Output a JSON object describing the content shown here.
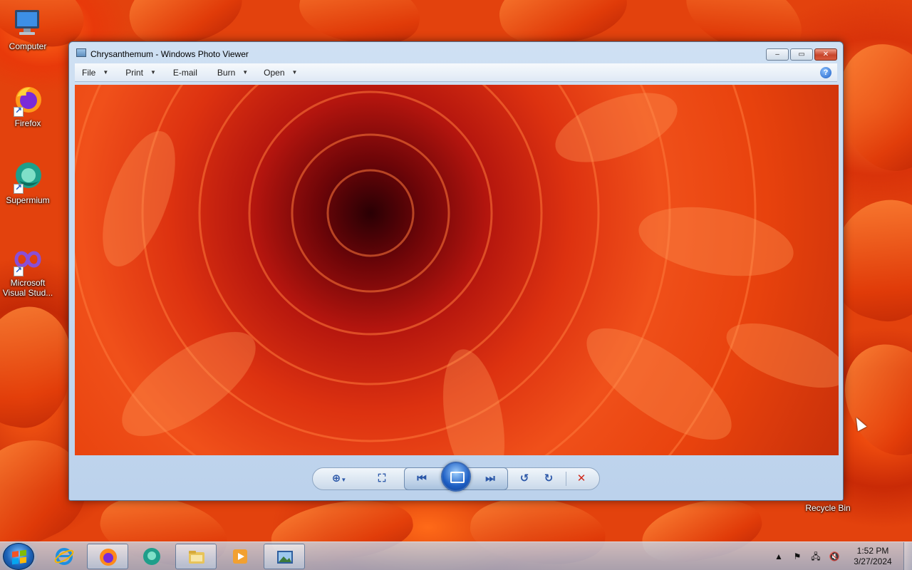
{
  "desktop": {
    "icons": [
      {
        "label": "Computer",
        "icon": "computer-icon"
      },
      {
        "label": "Firefox",
        "icon": "firefox-icon"
      },
      {
        "label": "Supermium",
        "icon": "supermium-icon"
      },
      {
        "label": "Microsoft Visual Stud...",
        "icon": "visual-studio-icon"
      }
    ],
    "recycle_bin_label": "Recycle Bin"
  },
  "window": {
    "title": "Chrysanthemum - Windows Photo Viewer",
    "caption_buttons": {
      "minimize": "–",
      "maximize": "▭",
      "close": "✕"
    },
    "menu": [
      {
        "label": "File",
        "has_dropdown": true
      },
      {
        "label": "Print",
        "has_dropdown": true
      },
      {
        "label": "E-mail",
        "has_dropdown": false
      },
      {
        "label": "Burn",
        "has_dropdown": true
      },
      {
        "label": "Open",
        "has_dropdown": true
      }
    ],
    "help_label": "?",
    "controls": [
      "zoom-icon",
      "actual-size-icon",
      "previous-icon",
      "slideshow-icon",
      "next-icon",
      "rotate-counterclockwise-icon",
      "rotate-clockwise-icon",
      "delete-icon"
    ]
  },
  "taskbar": {
    "pinned": [
      "internet-explorer-icon",
      "firefox-icon",
      "supermium-icon",
      "file-explorer-icon",
      "media-player-icon",
      "photo-viewer-icon"
    ],
    "clock": {
      "time": "1:52 PM",
      "date": "3/27/2024"
    },
    "tray": [
      "show-hidden-icons-icon",
      "action-center-flag-icon",
      "network-icon",
      "volume-muted-icon"
    ]
  },
  "colors": {
    "accent": "#1d63b8",
    "window_frame": "#bcd2ec",
    "wallpaper": "#e3420d",
    "delete_red": "#d0281a"
  }
}
